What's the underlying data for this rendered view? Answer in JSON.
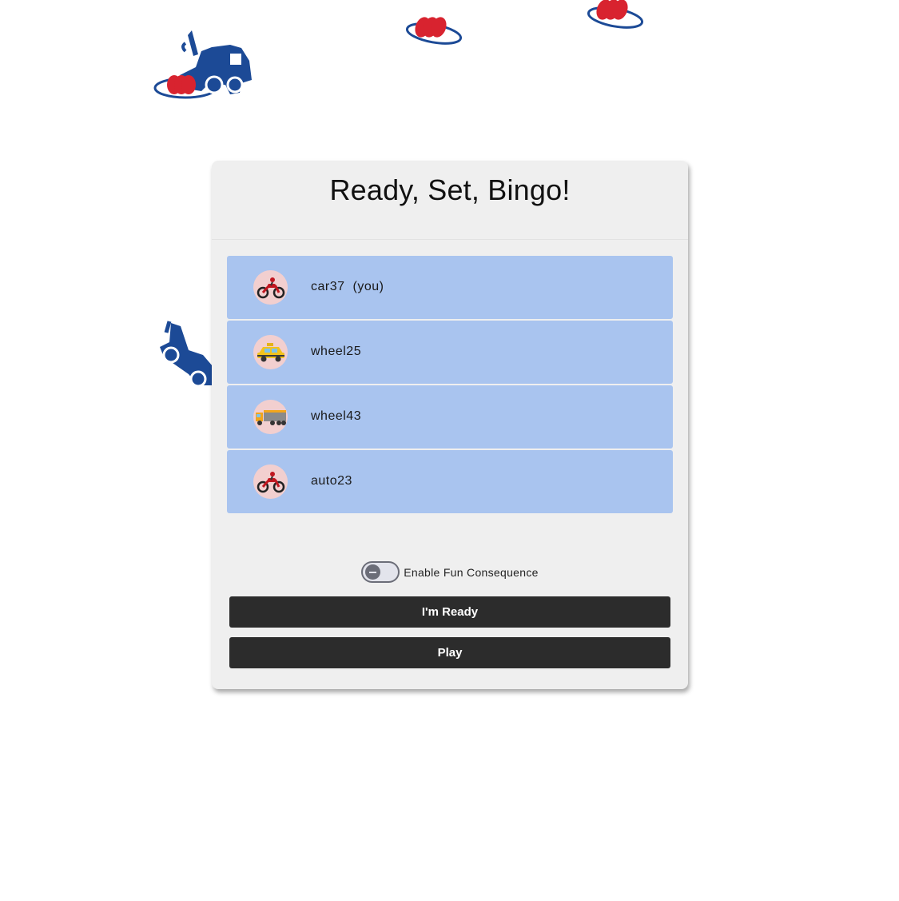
{
  "page": {
    "title": "Ready, Set, Bingo!"
  },
  "players": [
    {
      "name": "car37",
      "you_tag": "(you)",
      "avatar": "motorcycle-icon"
    },
    {
      "name": "wheel25",
      "you_tag": "",
      "avatar": "taxi-icon"
    },
    {
      "name": "wheel43",
      "you_tag": "",
      "avatar": "truck-icon"
    },
    {
      "name": "auto23",
      "you_tag": "",
      "avatar": "motorcycle-icon"
    }
  ],
  "controls": {
    "toggle_label": "Enable Fun Consequence",
    "toggle_on": false,
    "ready_label": "I'm Ready",
    "play_label": "Play"
  },
  "colors": {
    "brand_blue": "#1c4a96",
    "brand_red": "#d8232f",
    "row_bg": "#a9c4ef",
    "button_bg": "#2c2c2c"
  }
}
